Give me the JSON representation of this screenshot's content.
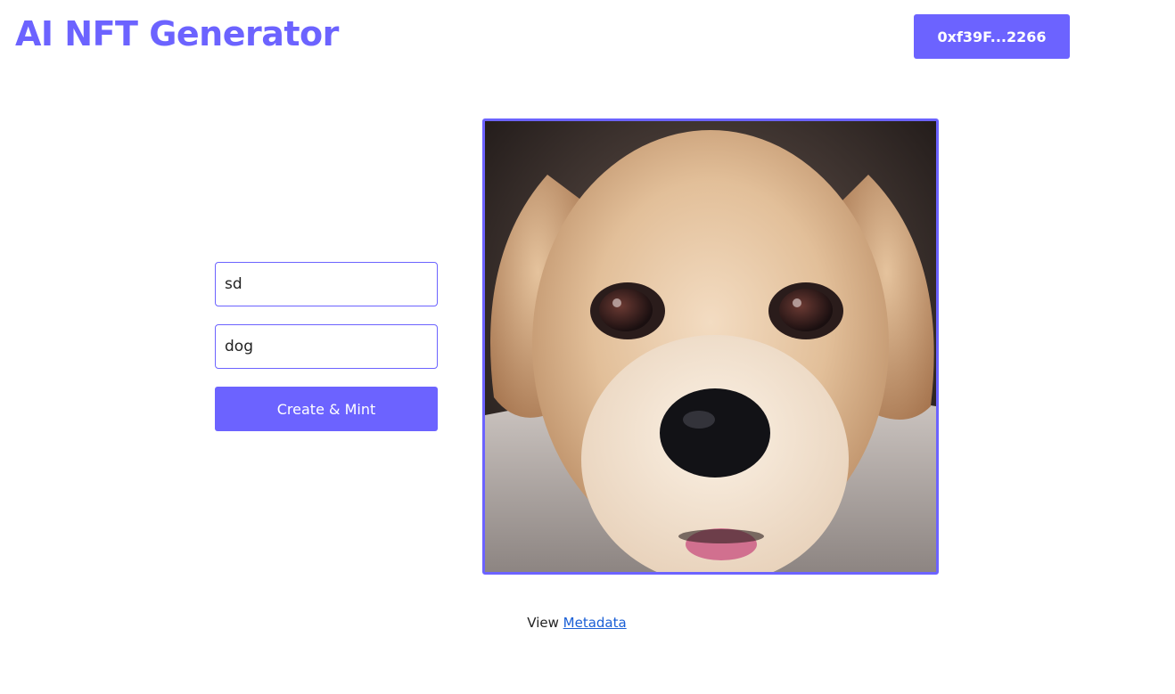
{
  "header": {
    "title": "AI NFT Generator",
    "wallet_address": "0xf39F...2266"
  },
  "form": {
    "name_value": "sd",
    "description_value": "dog",
    "submit_label": "Create & Mint"
  },
  "preview": {
    "image_icon": "generated-dog-image"
  },
  "footer": {
    "view_label": "View",
    "metadata_link": "Metadata"
  },
  "colors": {
    "accent": "#6c63ff",
    "link": "#1a5fd6"
  }
}
